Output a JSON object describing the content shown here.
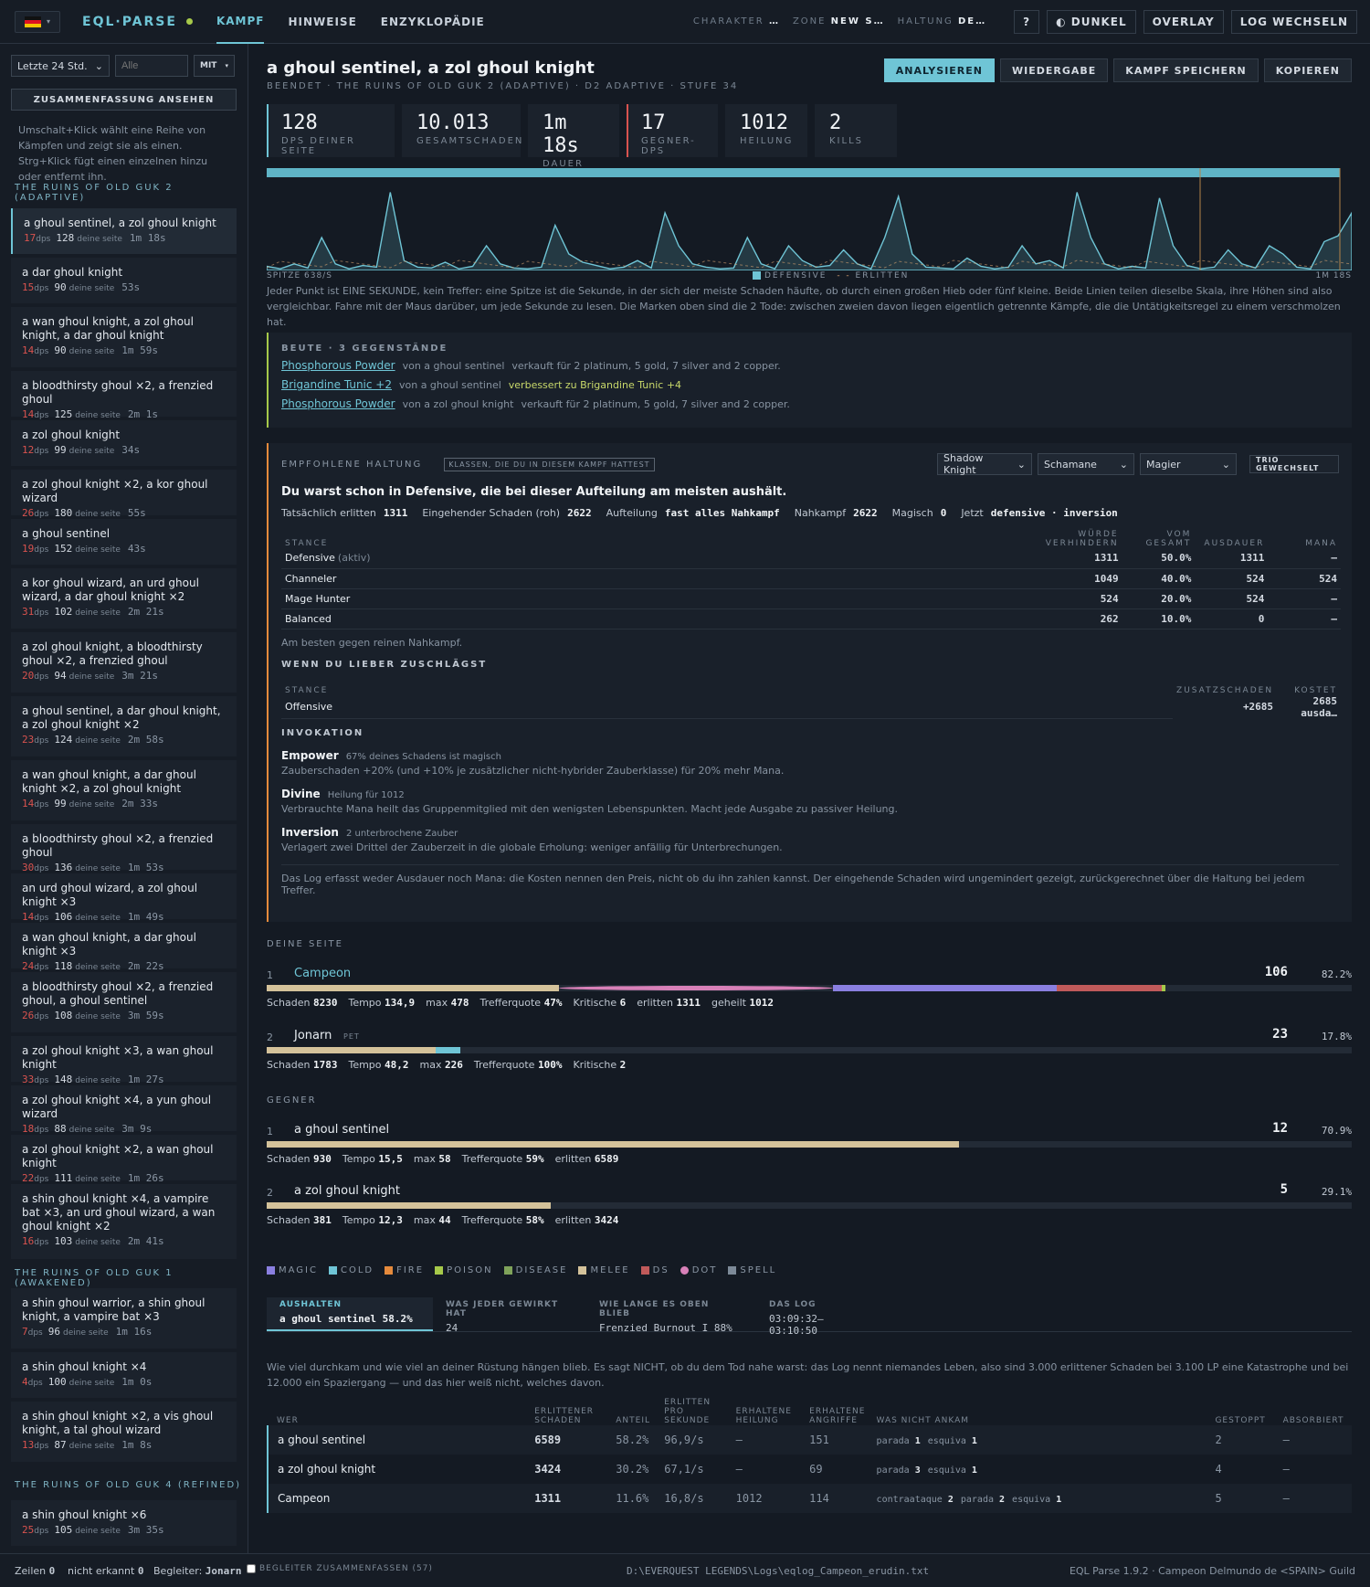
{
  "topbar": {
    "logo": "EQL·PARSE",
    "tabs": [
      "KAMPF",
      "HINWEISE",
      "ENZYKLOPÄDIE"
    ],
    "charakter": "CHARAKTER",
    "charakter_val": "…",
    "zone": "ZONE",
    "zone_val": "NEW S…",
    "haltung": "HALTUNG",
    "haltung_val": "DE…",
    "help": "?",
    "theme": "◐ DUNKEL",
    "overlay": "OVERLAY",
    "log": "LOG WECHSELN"
  },
  "sidebar": {
    "range": "Letzte 24 Std.",
    "filter_placeholder": "Alle",
    "mit": "MIT",
    "summary_btn": "ZUSAMMENFASSUNG ANSEHEN",
    "hint": "Umschalt+Klick wählt eine Reihe von Kämpfen und zeigt sie als einen. Strg+Klick fügt einen einzelnen hinzu oder entfernt ihn.",
    "dps_label": "dps",
    "mine_label": "deine seite",
    "zones": [
      {
        "name": "THE RUINS OF OLD GUK 2 (ADAPTIVE)",
        "fights": [
          {
            "title": "a ghoul sentinel, a zol ghoul knight",
            "dps": "17",
            "mine": "128",
            "dur": "1m 18s"
          },
          {
            "title": "a dar ghoul knight",
            "dps": "15",
            "mine": "90",
            "dur": "53s"
          },
          {
            "title": "a wan ghoul knight, a zol ghoul knight, a dar ghoul knight",
            "dps": "14",
            "mine": "90",
            "dur": "1m 59s"
          },
          {
            "title": "a bloodthirsty ghoul ×2, a frenzied ghoul",
            "dps": "14",
            "mine": "125",
            "dur": "2m 1s"
          },
          {
            "title": "a zol ghoul knight",
            "dps": "12",
            "mine": "99",
            "dur": "34s"
          },
          {
            "title": "a zol ghoul knight ×2, a kor ghoul wizard",
            "dps": "26",
            "mine": "180",
            "dur": "55s"
          },
          {
            "title": "a ghoul sentinel",
            "dps": "19",
            "mine": "152",
            "dur": "43s"
          },
          {
            "title": "a kor ghoul wizard, an urd ghoul wizard, a dar ghoul knight ×2",
            "dps": "31",
            "mine": "102",
            "dur": "2m 21s"
          },
          {
            "title": "a zol ghoul knight, a bloodthirsty ghoul ×2, a frenzied ghoul",
            "dps": "20",
            "mine": "94",
            "dur": "3m 21s"
          },
          {
            "title": "a ghoul sentinel, a dar ghoul knight, a zol ghoul knight ×2",
            "dps": "23",
            "mine": "124",
            "dur": "2m 58s"
          },
          {
            "title": "a wan ghoul knight, a dar ghoul knight ×2, a zol ghoul knight",
            "dps": "14",
            "mine": "99",
            "dur": "2m 33s"
          },
          {
            "title": "a bloodthirsty ghoul ×2, a frenzied ghoul",
            "dps": "30",
            "mine": "136",
            "dur": "1m 53s"
          },
          {
            "title": "an urd ghoul wizard, a zol ghoul knight ×3",
            "dps": "14",
            "mine": "106",
            "dur": "1m 49s"
          },
          {
            "title": "a wan ghoul knight, a dar ghoul knight ×3",
            "dps": "24",
            "mine": "118",
            "dur": "2m 22s"
          },
          {
            "title": "a bloodthirsty ghoul ×2, a frenzied ghoul, a ghoul sentinel",
            "dps": "26",
            "mine": "108",
            "dur": "3m 59s"
          },
          {
            "title": "a zol ghoul knight ×3, a wan ghoul knight",
            "dps": "33",
            "mine": "148",
            "dur": "1m 27s"
          },
          {
            "title": "a zol ghoul knight ×4, a yun ghoul wizard",
            "dps": "18",
            "mine": "88",
            "dur": "3m 9s"
          },
          {
            "title": "a zol ghoul knight ×2, a wan ghoul knight",
            "dps": "22",
            "mine": "111",
            "dur": "1m 26s"
          },
          {
            "title": "a shin ghoul knight ×4, a vampire bat ×3, an urd ghoul wizard, a wan ghoul knight ×2",
            "dps": "16",
            "mine": "103",
            "dur": "2m 41s"
          }
        ]
      },
      {
        "name": "THE RUINS OF OLD GUK 1 (AWAKENED)",
        "fights": [
          {
            "title": "a shin ghoul warrior, a shin ghoul knight, a vampire bat ×3",
            "dps": "7",
            "mine": "96",
            "dur": "1m 16s"
          },
          {
            "title": "a shin ghoul knight ×4",
            "dps": "4",
            "mine": "100",
            "dur": "1m 0s"
          },
          {
            "title": "a shin ghoul knight ×2, a vis ghoul knight, a tal ghoul wizard",
            "dps": "13",
            "mine": "87",
            "dur": "1m 8s"
          }
        ]
      },
      {
        "name": "THE RUINS OF OLD GUK 4 (REFINED)",
        "fights": [
          {
            "title": "a shin ghoul knight ×6",
            "dps": "25",
            "mine": "105",
            "dur": "3m 35s"
          }
        ]
      }
    ]
  },
  "fight": {
    "title": "a ghoul sentinel, a zol ghoul knight",
    "subtitle": "BEENDET · THE RUINS OF OLD GUK 2 (ADAPTIVE) · D2 ADAPTIVE · STUFE 34",
    "buttons": [
      "ANALYSIEREN",
      "WIEDERGABE",
      "KAMPF SPEICHERN",
      "KOPIEREN"
    ],
    "kpis": [
      {
        "v": "128",
        "l": "DPS DEINER SEITE"
      },
      {
        "v": "10.013",
        "l": "GESAMTSCHADEN"
      },
      {
        "v": "1m 18s",
        "l": "DAUER"
      },
      {
        "v": "17",
        "l": "GEGNER-DPS"
      },
      {
        "v": "1012",
        "l": "HEILUNG"
      },
      {
        "v": "2",
        "l": "KILLS"
      }
    ],
    "chart_peak": "SPITZE 638/S",
    "chart_end": "1M 18S",
    "legend_def": "DEFENSIVE",
    "legend_erl": "ERLITTEN",
    "chart_note": "Jeder Punkt ist EINE SEKUNDE, kein Treffer: eine Spitze ist die Sekunde, in der sich der meiste Schaden häufte, ob durch einen großen Hieb oder fünf kleine. Beide Linien teilen dieselbe Skala, ihre Höhen sind also vergleichbar. Fahre mit der Maus darüber, um jede Sekunde zu lesen. Die Marken oben sind die 2 Tode: zwischen zweien davon liegen eigentlich getrennte Kämpfe, die die Untätigkeitsregel zu einem verschmolzen hat."
  },
  "loot": {
    "header": "BEUTE · 3 GEGENSTÄNDE",
    "items": [
      {
        "name": "Phosphorous Powder",
        "from": "von a ghoul sentinel",
        "note": "verkauft für 2 platinum, 5 gold, 7 silver and 2 copper.",
        "upgrade": false
      },
      {
        "name": "Brigandine Tunic +2",
        "from": "von a ghoul sentinel",
        "note": "verbessert zu Brigandine Tunic +4",
        "upgrade": true
      },
      {
        "name": "Phosphorous Powder",
        "from": "von a zol ghoul knight",
        "note": "verkauft für 2 platinum, 5 gold, 7 silver and 2 copper.",
        "upgrade": false
      }
    ]
  },
  "stance": {
    "header": "EMPFOHLENE HALTUNG",
    "tag": "KLASSEN, DIE DU IN DIESEM KAMPF HATTEST",
    "classes": [
      "Shadow Knight",
      "Schamane",
      "Magier"
    ],
    "trio": "TRIO GEWECHSELT",
    "headline": "Du warst schon in Defensive, die bei dieser Aufteilung am meisten aushält.",
    "facts": [
      {
        "k": "Tatsächlich erlitten",
        "v": "1311"
      },
      {
        "k": "Eingehender Schaden (roh)",
        "v": "2622"
      },
      {
        "k": "Aufteilung",
        "v": "fast alles Nahkampf"
      },
      {
        "k": "Nahkampf",
        "v": "2622"
      },
      {
        "k": "Magisch",
        "v": "0"
      },
      {
        "k": "Jetzt",
        "v": "defensive · inversion"
      }
    ],
    "cols": [
      "STANCE",
      "WÜRDE VERHINDERN",
      "VOM GESAMT",
      "AUSDAUER",
      "MANA"
    ],
    "rows": [
      {
        "n": "Defensive",
        "tag": "(aktiv)",
        "a": "1311",
        "b": "50.0%",
        "c": "1311",
        "d": "–"
      },
      {
        "n": "Channeler",
        "tag": "",
        "a": "1049",
        "b": "40.0%",
        "c": "524",
        "d": "524"
      },
      {
        "n": "Mage Hunter",
        "tag": "",
        "a": "524",
        "b": "20.0%",
        "c": "524",
        "d": "–"
      },
      {
        "n": "Balanced",
        "tag": "",
        "a": "262",
        "b": "10.0%",
        "c": "0",
        "d": "–"
      }
    ],
    "best": "Am besten gegen reinen Nahkampf.",
    "strike_h": "WENN DU LIEBER ZUSCHLÄGST",
    "strike_cols": [
      "STANCE",
      "ZUSATZSCHADEN",
      "KOSTET"
    ],
    "strike": {
      "n": "Offensive",
      "a": "+2685",
      "b": "2685 ausda…"
    },
    "inv_h": "INVOKATION",
    "inv": [
      {
        "n": "Empower",
        "s": "67% deines Schadens ist magisch",
        "d": "Zauberschaden +20% (und +10% je zusätzlicher nicht-hybrider Zauberklasse) für 20% mehr Mana."
      },
      {
        "n": "Divine",
        "s": "Heilung für 1012",
        "d": "Verbrauchte Mana heilt das Gruppenmitglied mit den wenigsten Lebenspunkten. Macht jede Ausgabe zu passiver Heilung."
      },
      {
        "n": "Inversion",
        "s": "2 unterbrochene Zauber",
        "d": "Verlagert zwei Drittel der Zauberzeit in die globale Erholung: weniger anfällig für Unterbrechungen."
      }
    ],
    "foot": "Das Log erfasst weder Ausdauer noch Mana: die Kosten nennen den Preis, nicht ob du ihn zahlen kannst. Der eingehende Schaden wird ungemindert gezeigt, zurückgerechnet über die Haltung bei jedem Treffer."
  },
  "side": {
    "header": "DEINE SEITE",
    "rows": [
      {
        "i": "1",
        "n": "Campeon",
        "pet": "",
        "v": "106",
        "p": "82.2%",
        "stats": [
          {
            "k": "Schaden",
            "v": "8230"
          },
          {
            "k": "Tempo",
            "v": "134,9"
          },
          {
            "k": "max",
            "v": "478"
          },
          {
            "k": "Trefferquote",
            "v": "47%"
          },
          {
            "k": "Kritische",
            "v": "6"
          },
          {
            "k": "erlitten",
            "v": "1311"
          },
          {
            "k": "geheilt",
            "v": "1012"
          }
        ]
      },
      {
        "i": "2",
        "n": "Jonarn",
        "pet": "PET",
        "v": "23",
        "p": "17.8%",
        "stats": [
          {
            "k": "Schaden",
            "v": "1783"
          },
          {
            "k": "Tempo",
            "v": "48,2"
          },
          {
            "k": "max",
            "v": "226"
          },
          {
            "k": "Trefferquote",
            "v": "100%"
          },
          {
            "k": "Kritische",
            "v": "2"
          }
        ]
      }
    ]
  },
  "enemies": {
    "header": "GEGNER",
    "rows": [
      {
        "i": "1",
        "n": "a ghoul sentinel",
        "v": "12",
        "p": "70.9%",
        "fill": 0.709,
        "stats": [
          {
            "k": "Schaden",
            "v": "930"
          },
          {
            "k": "Tempo",
            "v": "15,5"
          },
          {
            "k": "max",
            "v": "58"
          },
          {
            "k": "Trefferquote",
            "v": "59%"
          },
          {
            "k": "erlitten",
            "v": "6589"
          }
        ]
      },
      {
        "i": "2",
        "n": "a zol ghoul knight",
        "v": "5",
        "p": "29.1%",
        "fill": 0.291,
        "stats": [
          {
            "k": "Schaden",
            "v": "381"
          },
          {
            "k": "Tempo",
            "v": "12,3"
          },
          {
            "k": "max",
            "v": "44"
          },
          {
            "k": "Trefferquote",
            "v": "58%"
          },
          {
            "k": "erlitten",
            "v": "3424"
          }
        ]
      }
    ]
  },
  "dmg_legend": [
    {
      "n": "MAGIC",
      "c": "#8a7fe0"
    },
    {
      "n": "COLD",
      "c": "#6fc5d6"
    },
    {
      "n": "FIRE",
      "c": "#e58a3c"
    },
    {
      "n": "POISON",
      "c": "#a6c94a"
    },
    {
      "n": "DISEASE",
      "c": "#7fa35a"
    },
    {
      "n": "MELEE",
      "c": "#d4c29a"
    },
    {
      "n": "DS",
      "c": "#c05a5a"
    },
    {
      "n": "DOT",
      "c": "#d880b8"
    },
    {
      "n": "SPELL",
      "c": "#7d8a98"
    }
  ],
  "tabs": [
    {
      "l": "AUSHALTEN",
      "v": "a ghoul sentinel 58.2%"
    },
    {
      "l": "WAS JEDER GEWIRKT HAT",
      "v": "24"
    },
    {
      "l": "WIE LANGE ES OBEN BLIEB",
      "v": "Frenzied Burnout I 88%"
    },
    {
      "l": "DAS LOG",
      "v": "03:09:32–03:10:50"
    }
  ],
  "tank": {
    "note": "Wie viel durchkam und wie viel an deiner Rüstung hängen blieb. Es sagt NICHT, ob du dem Tod nahe warst: das Log nennt niemandes Leben, also sind 3.000 erlittener Schaden bei 3.100 LP eine Katastrophe und bei 12.000 ein Spaziergang — und das hier weiß nicht, welches davon.",
    "cols": [
      "WER",
      "ERLITTENER SCHADEN",
      "ANTEIL",
      "ERLITTEN PRO SEKUNDE",
      "ERHALTENE HEILUNG",
      "ERHALTENE ANGRIFFE",
      "WAS NICHT ANKAM",
      "GESTOPPT",
      "ABSORBIERT"
    ],
    "rows": [
      {
        "n": "a ghoul sentinel",
        "a": "6589",
        "b": "58.2%",
        "c": "96,9/s",
        "d": "–",
        "e": "151",
        "w": [
          [
            "parada",
            "1"
          ],
          [
            "esquiva",
            "1"
          ]
        ],
        "g": "2",
        "h": "–"
      },
      {
        "n": "a zol ghoul knight",
        "a": "3424",
        "b": "30.2%",
        "c": "67,1/s",
        "d": "–",
        "e": "69",
        "w": [
          [
            "parada",
            "3"
          ],
          [
            "esquiva",
            "1"
          ]
        ],
        "g": "4",
        "h": "–"
      },
      {
        "n": "Campeon",
        "a": "1311",
        "b": "11.6%",
        "c": "16,8/s",
        "d": "1012",
        "e": "114",
        "w": [
          [
            "contraataque",
            "2"
          ],
          [
            "parada",
            "2"
          ],
          [
            "esquiva",
            "1"
          ]
        ],
        "g": "5",
        "h": "–"
      }
    ]
  },
  "status": {
    "zeilen": "Zeilen",
    "zeilen_v": "0",
    "unerkannt": "nicht erkannt",
    "unerkannt_v": "0",
    "begleiter": "Begleiter:",
    "begleiter_v": "Jonarn",
    "merge": "BEGLEITER ZUSAMMENFASSEN (57)",
    "path": "D:\\EVERQUEST LEGENDS\\Logs\\eqlog_Campeon_erudin.txt",
    "version": "EQL Parse 1.9.2 · Campeon Delmundo de <SPAIN> Guild"
  }
}
